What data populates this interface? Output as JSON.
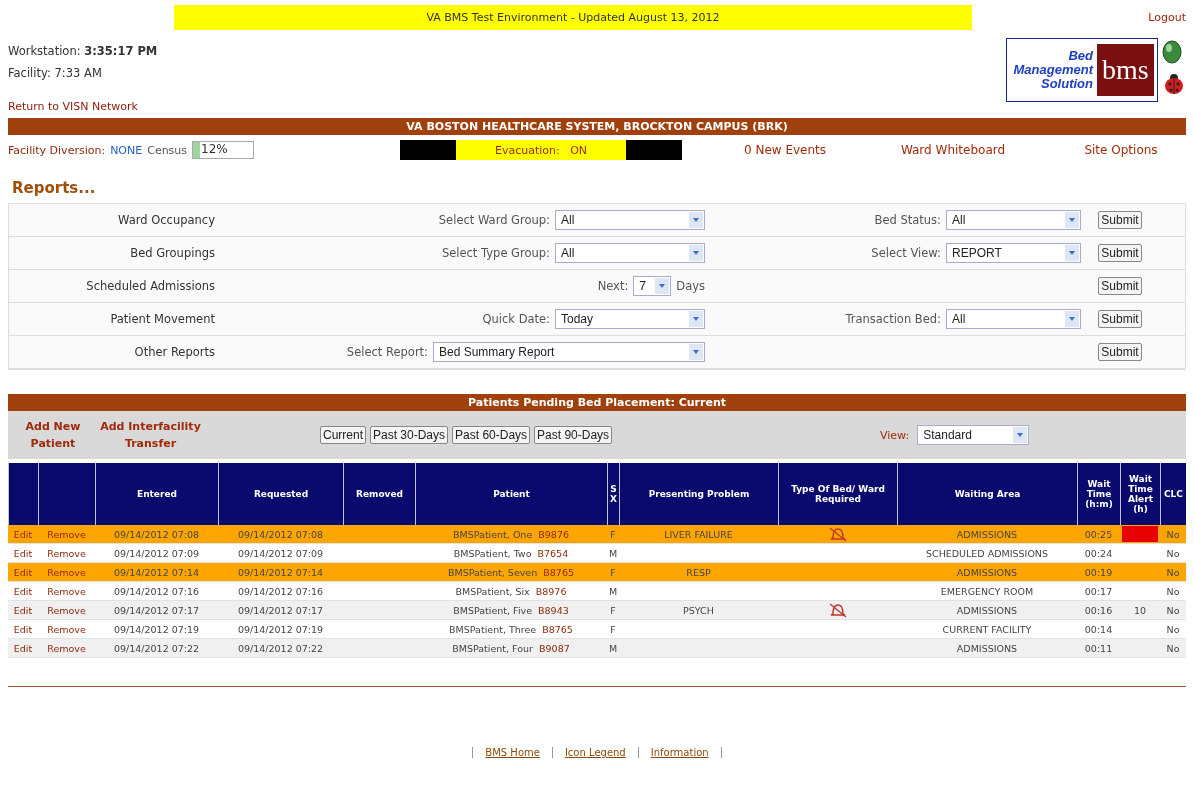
{
  "banner": {
    "text": "VA BMS Test Environment - Updated August 13, 2012"
  },
  "logout": "Logout",
  "clock": [
    {
      "label": "Workstation:",
      "value": "3:35:17 PM",
      "bold": true
    },
    {
      "label": "Facility:",
      "value": "7:33 AM",
      "bold": false
    }
  ],
  "return_link": "Return to VISN Network",
  "logo": {
    "lines": [
      "Bed",
      "Management",
      "Solution"
    ],
    "mark": "bms"
  },
  "facility_bar": "VA BOSTON HEALTHCARE SYSTEM, BROCKTON CAMPUS (BRK)",
  "status": {
    "diversion_label": "Facility Diversion:",
    "diversion_value": "NONE",
    "census": {
      "label": "Census",
      "value": "12%",
      "level": 0.12
    },
    "evacuation_label": "Evacuation:",
    "evacuation_value": "ON",
    "links": [
      "0 New Events",
      "Ward Whiteboard",
      "Site Options"
    ]
  },
  "reports": {
    "title": "Reports...",
    "rows": [
      {
        "name": "Ward Occupancy",
        "field1": {
          "label": "Select Ward Group:",
          "value": "All",
          "kind": "select"
        },
        "field2": {
          "label": "Bed Status:",
          "value": "All"
        },
        "submit": "Submit"
      },
      {
        "name": "Bed Groupings",
        "field1": {
          "label": "Select Type Group:",
          "value": "All",
          "kind": "select"
        },
        "field2": {
          "label": "Select View:",
          "value": "REPORT"
        },
        "submit": "Submit"
      },
      {
        "name": "Scheduled Admissions",
        "field1": {
          "label": "Next:",
          "value": "7",
          "suffix": "Days",
          "kind": "small"
        },
        "submit": "Submit"
      },
      {
        "name": "Patient Movement",
        "field1": {
          "label": "Quick Date:",
          "value": "Today",
          "kind": "select"
        },
        "field2": {
          "label": "Transaction Bed:",
          "value": "All"
        },
        "submit": "Submit"
      },
      {
        "name": "Other Reports",
        "field1": {
          "label": "Select Report:",
          "value": "Bed Summary Report",
          "kind": "wide"
        },
        "submit": "Submit"
      }
    ]
  },
  "pending": {
    "title": "Patients Pending Bed Placement: Current",
    "actions": [
      "Add New Patient",
      "Add Interfacility Transfer"
    ],
    "ranges": [
      "Current",
      "Past 30-Days",
      "Past 60-Days",
      "Past 90-Days"
    ],
    "view_label": "View:",
    "view_value": "Standard",
    "columns": [
      "",
      "",
      "Entered",
      "Requested",
      "Removed",
      "Patient",
      "SX",
      "Presenting Problem",
      "Type Of Bed/ Ward Required",
      "Waiting Area",
      "Wait Time (h:m)",
      "Wait Time Alert (h)",
      "CLC"
    ],
    "rows": [
      {
        "edit": "Edit",
        "remove": "Remove",
        "entered": "09/14/2012 07:08",
        "requested": "09/14/2012 07:08",
        "patient": "BMSPatient, One",
        "id": "B9876",
        "sex": "F",
        "problem": "LIVER FAILURE",
        "bed_icon": true,
        "area": "ADMISSIONS",
        "wait": "00:25",
        "alert_flag": true,
        "clc": "No",
        "highlighted": true
      },
      {
        "edit": "Edit",
        "remove": "Remove",
        "entered": "09/14/2012 07:09",
        "requested": "09/14/2012 07:09",
        "patient": "BMSPatient, Two",
        "id": "B7654",
        "sex": "M",
        "bed_icon": false,
        "area": "SCHEDULED ADMISSIONS",
        "wait": "00:24",
        "alert_flag": false,
        "clc": "No",
        "highlighted": false
      },
      {
        "edit": "Edit",
        "remove": "Remove",
        "entered": "09/14/2012 07:14",
        "requested": "09/14/2012 07:14",
        "patient": "BMSPatient, Seven",
        "id": "B8765",
        "sex": "F",
        "problem": "RESP",
        "bed_icon": false,
        "area": "ADMISSIONS",
        "wait": "00:19",
        "alert_flag": false,
        "clc": "No",
        "highlighted": true
      },
      {
        "edit": "Edit",
        "remove": "Remove",
        "entered": "09/14/2012 07:16",
        "requested": "09/14/2012 07:16",
        "patient": "BMSPatient, Six",
        "id": "B8976",
        "sex": "M",
        "bed_icon": false,
        "area": "EMERGENCY ROOM",
        "wait": "00:17",
        "alert_flag": false,
        "clc": "No",
        "highlighted": false
      },
      {
        "edit": "Edit",
        "remove": "Remove",
        "entered": "09/14/2012 07:17",
        "requested": "09/14/2012 07:17",
        "patient": "BMSPatient, Five",
        "id": "B8943",
        "sex": "F",
        "problem": "PSYCH",
        "bed_icon": true,
        "area": "ADMISSIONS",
        "wait": "00:16",
        "alert": "10",
        "alert_flag": false,
        "clc": "No",
        "highlighted": false
      },
      {
        "edit": "Edit",
        "remove": "Remove",
        "entered": "09/14/2012 07:19",
        "requested": "09/14/2012 07:19",
        "patient": "BMSPatient, Three",
        "id": "B8765",
        "sex": "F",
        "bed_icon": false,
        "area": "CURRENT FACILITY",
        "wait": "00:14",
        "alert_flag": false,
        "clc": "No",
        "highlighted": false
      },
      {
        "edit": "Edit",
        "remove": "Remove",
        "entered": "09/14/2012 07:22",
        "requested": "09/14/2012 07:22",
        "patient": "BMSPatient, Four",
        "id": "B9087",
        "sex": "M",
        "bed_icon": false,
        "area": "ADMISSIONS",
        "wait": "00:11",
        "alert_flag": false,
        "clc": "No",
        "highlighted": false
      }
    ]
  },
  "footer": [
    "BMS Home",
    "Icon Legend",
    "Information"
  ]
}
